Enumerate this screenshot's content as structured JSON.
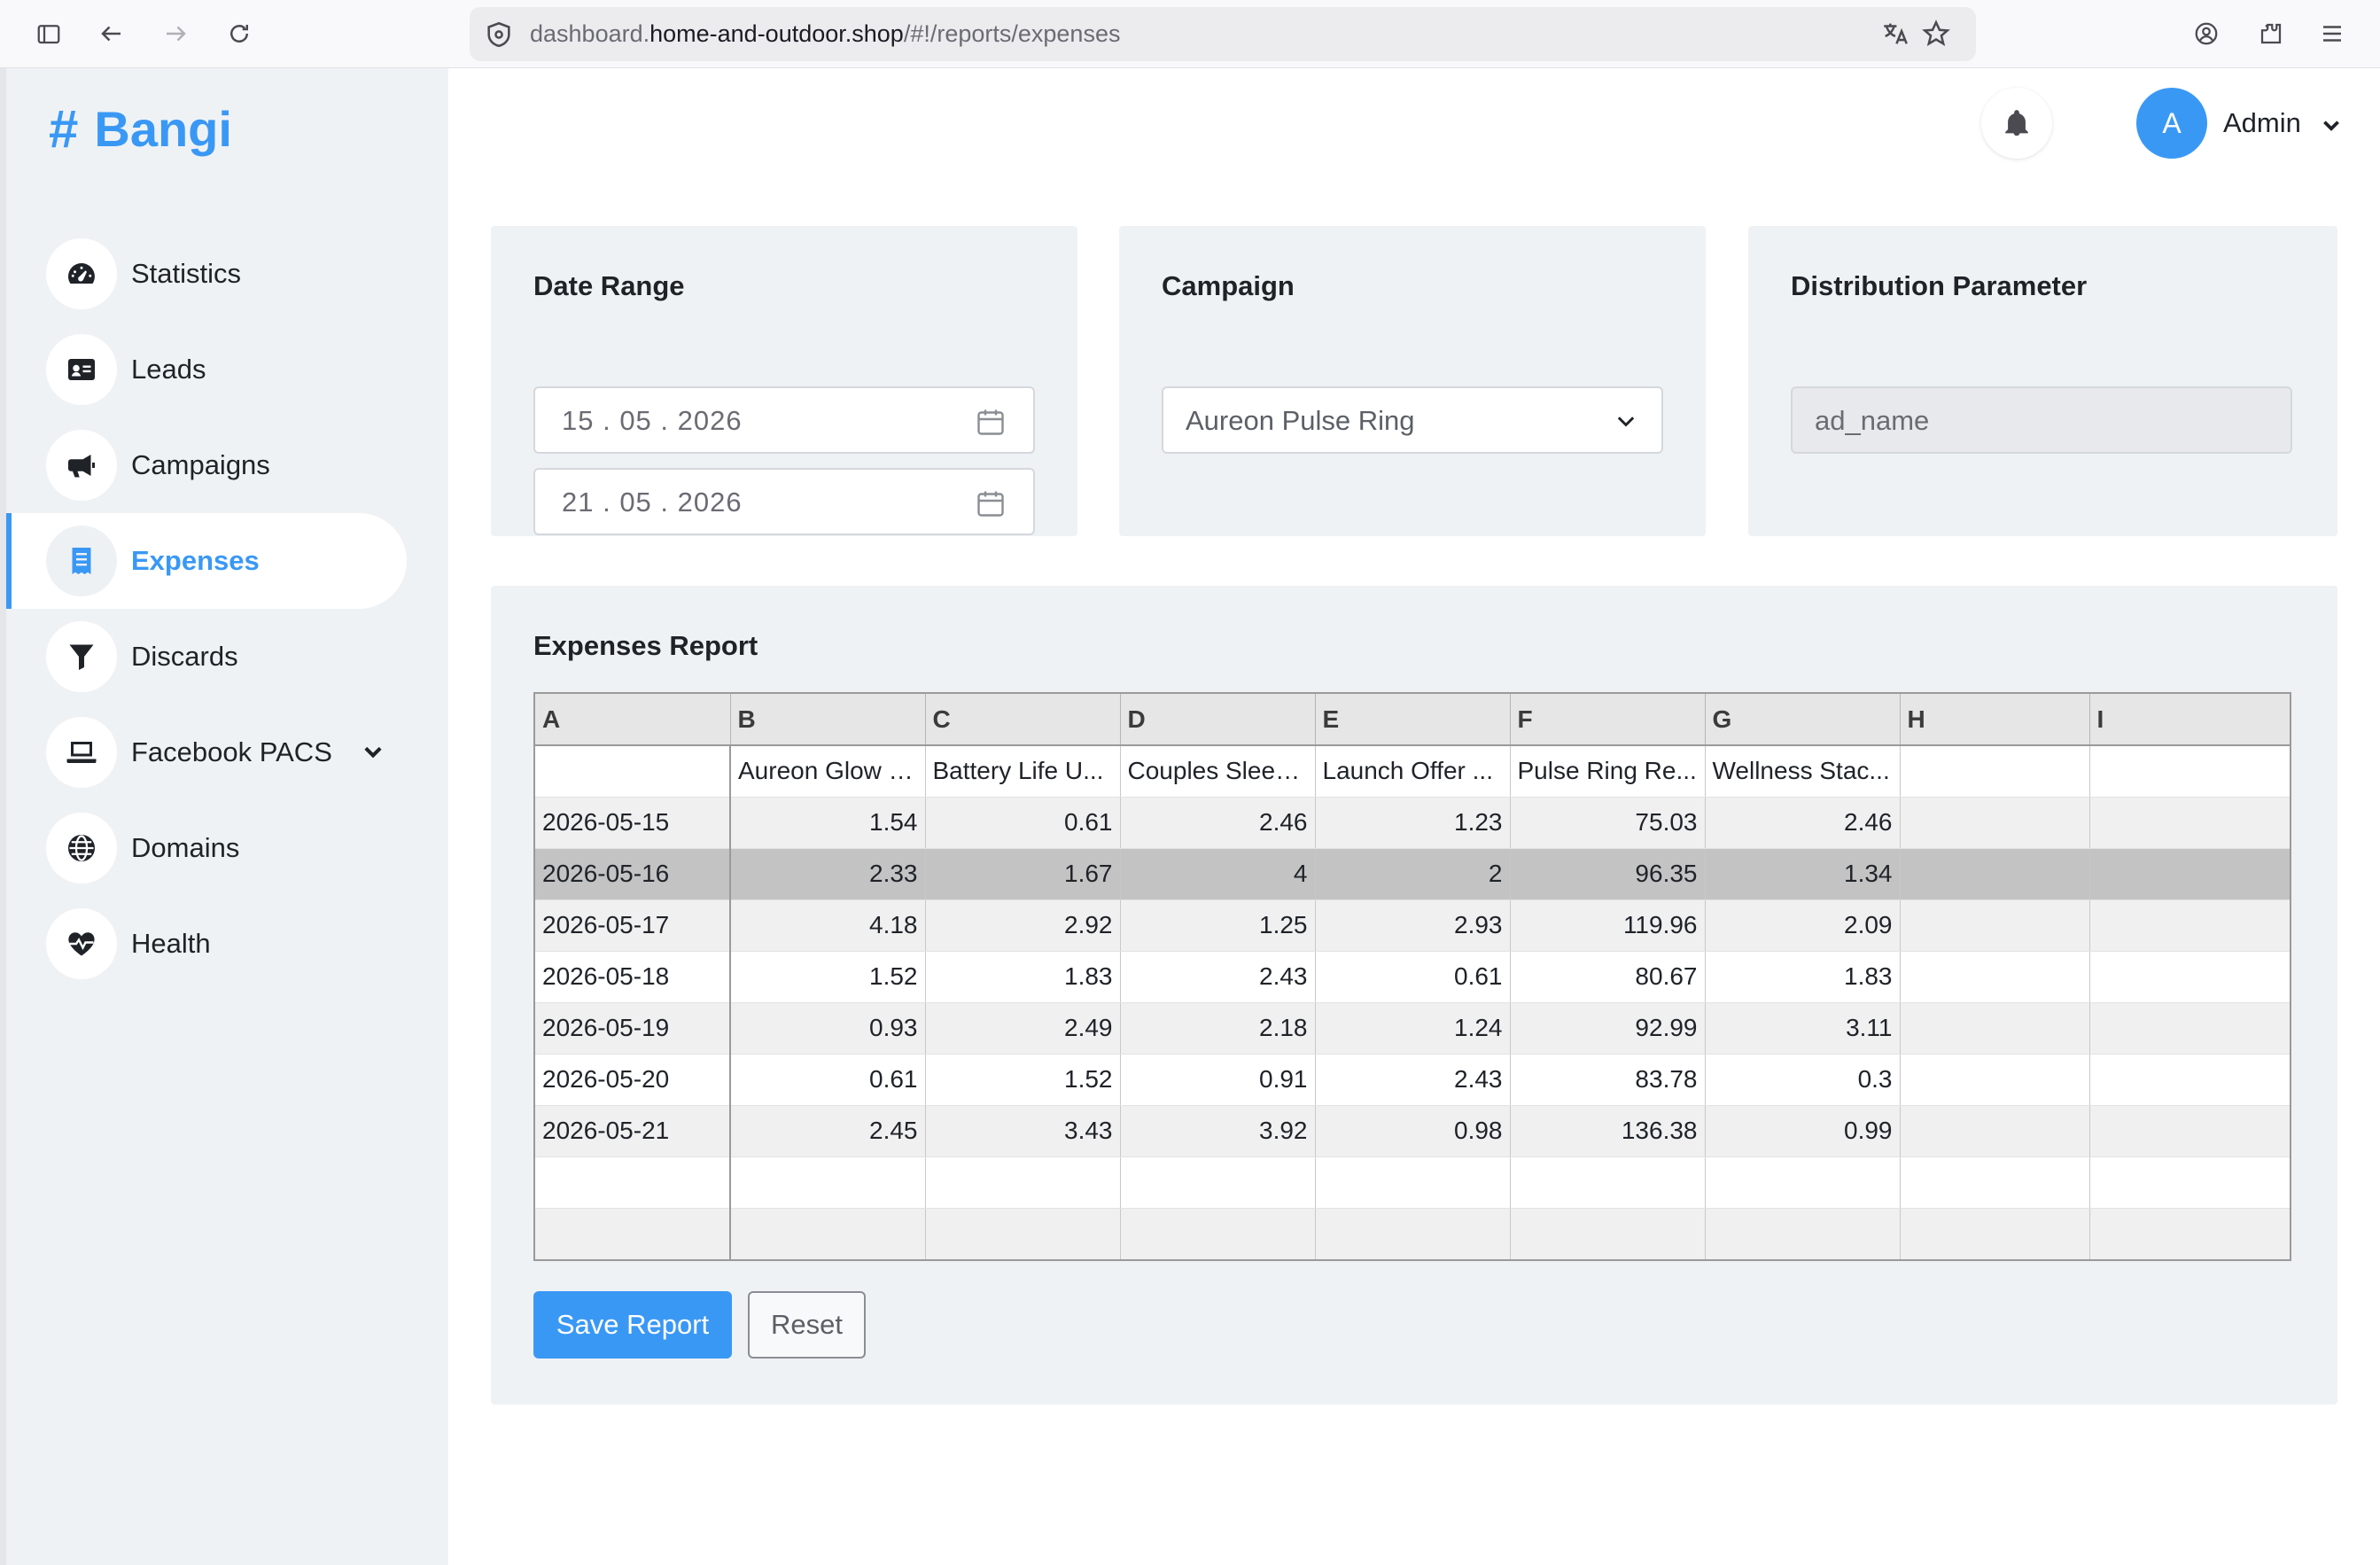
{
  "browser": {
    "url_prefix": "dashboard.",
    "url_host": "home-and-outdoor.shop",
    "url_path": "/#!/reports/expenses"
  },
  "app": {
    "logo": "Bangi",
    "logo_hash": "#",
    "accent_color": "#3a98f5"
  },
  "sidebar": {
    "items": [
      {
        "label": "Statistics",
        "icon": "speedometer-icon"
      },
      {
        "label": "Leads",
        "icon": "id-card-icon"
      },
      {
        "label": "Campaigns",
        "icon": "megaphone-icon"
      },
      {
        "label": "Expenses",
        "icon": "receipt-icon",
        "active": true
      },
      {
        "label": "Discards",
        "icon": "filter-icon"
      },
      {
        "label": "Facebook PACS",
        "icon": "laptop-icon",
        "has_submenu": true
      },
      {
        "label": "Domains",
        "icon": "globe-icon"
      },
      {
        "label": "Health",
        "icon": "heart-pulse-icon"
      }
    ]
  },
  "header": {
    "avatar_initial": "A",
    "user_name": "Admin"
  },
  "filters": {
    "date_range": {
      "title": "Date Range",
      "start": "15 . 05 . 2026",
      "end": "21 . 05 . 2026"
    },
    "campaign": {
      "title": "Campaign",
      "selected": "Aureon Pulse Ring"
    },
    "distribution": {
      "title": "Distribution Parameter",
      "value": "ad_name"
    }
  },
  "report": {
    "title": "Expenses Report",
    "column_letters": [
      "A",
      "B",
      "C",
      "D",
      "E",
      "F",
      "G",
      "H",
      "I"
    ],
    "header_row": [
      "",
      "Aureon Glow S...",
      "Battery Life U...",
      "Couples Sleep...",
      "Launch Offer ...",
      "Pulse Ring Re...",
      "Wellness Stac...",
      "",
      ""
    ],
    "rows": [
      [
        "2026-05-15",
        "1.54",
        "0.61",
        "2.46",
        "1.23",
        "75.03",
        "2.46",
        "",
        ""
      ],
      [
        "2026-05-16",
        "2.33",
        "1.67",
        "4",
        "2",
        "96.35",
        "1.34",
        "",
        ""
      ],
      [
        "2026-05-17",
        "4.18",
        "2.92",
        "1.25",
        "2.93",
        "119.96",
        "2.09",
        "",
        ""
      ],
      [
        "2026-05-18",
        "1.52",
        "1.83",
        "2.43",
        "0.61",
        "80.67",
        "1.83",
        "",
        ""
      ],
      [
        "2026-05-19",
        "0.93",
        "2.49",
        "2.18",
        "1.24",
        "92.99",
        "3.11",
        "",
        ""
      ],
      [
        "2026-05-20",
        "0.61",
        "1.52",
        "0.91",
        "2.43",
        "83.78",
        "0.3",
        "",
        ""
      ],
      [
        "2026-05-21",
        "2.45",
        "3.43",
        "3.92",
        "0.98",
        "136.38",
        "0.99",
        "",
        ""
      ],
      [
        "",
        "",
        "",
        "",
        "",
        "",
        "",
        "",
        ""
      ],
      [
        "",
        "",
        "",
        "",
        "",
        "",
        "",
        "",
        ""
      ]
    ],
    "save_label": "Save Report",
    "reset_label": "Reset"
  }
}
